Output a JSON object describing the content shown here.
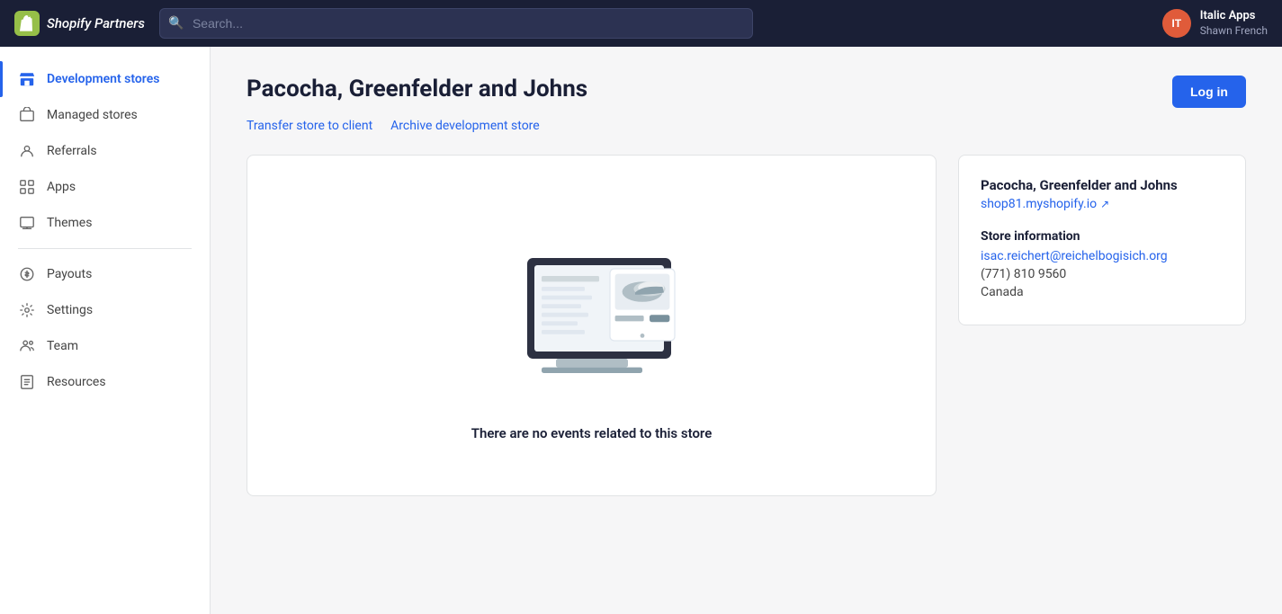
{
  "topnav": {
    "logo_text": "Shopify Partners",
    "logo_initials": "S",
    "search_placeholder": "Search...",
    "user_initials": "IT",
    "user_name": "Italic Apps",
    "user_sub": "Shawn French"
  },
  "sidebar": {
    "items": [
      {
        "id": "development-stores",
        "label": "Development stores",
        "active": true
      },
      {
        "id": "managed-stores",
        "label": "Managed stores",
        "active": false
      },
      {
        "id": "referrals",
        "label": "Referrals",
        "active": false
      },
      {
        "id": "apps",
        "label": "Apps",
        "active": false
      },
      {
        "id": "themes",
        "label": "Themes",
        "active": false
      },
      {
        "id": "payouts",
        "label": "Payouts",
        "active": false
      },
      {
        "id": "settings",
        "label": "Settings",
        "active": false
      },
      {
        "id": "team",
        "label": "Team",
        "active": false
      },
      {
        "id": "resources",
        "label": "Resources",
        "active": false
      }
    ]
  },
  "page": {
    "title": "Pacocha, Greenfelder and Johns",
    "action_transfer": "Transfer store to client",
    "action_archive": "Archive development store",
    "login_button": "Log in",
    "empty_state_text": "There are no events related to this store"
  },
  "info_card": {
    "store_name": "Pacocha, Greenfelder and Johns",
    "store_url": "shop81.myshopify.io",
    "section_title": "Store information",
    "email": "isac.reichert@reichelbogisich.org",
    "phone": "(771) 810 9560",
    "country": "Canada"
  }
}
